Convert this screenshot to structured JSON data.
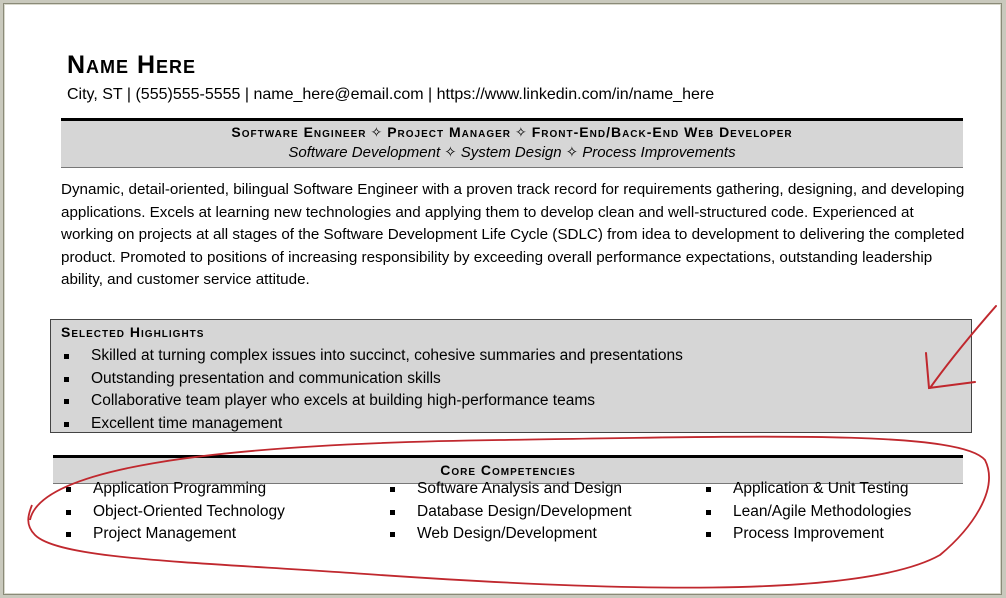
{
  "header": {
    "name": "Name Here",
    "contact": "City, ST | (555)555-5555 | name_here@email.com | https://www.linkedin.com/in/name_here"
  },
  "title_bar": {
    "roles": [
      "Software Engineer",
      "Project Manager",
      "Front-End/Back-End Web Developer"
    ],
    "skills": [
      "Software Development",
      "System Design",
      "Process Improvements"
    ],
    "separator_icon": "four-pointed-star-icon"
  },
  "summary": "Dynamic, detail-oriented, bilingual Software Engineer with a proven track record for requirements gathering, designing, and developing applications. Excels at learning new technologies and applying them to develop clean and well-structured code. Experienced at working on projects at all stages of the Software Development Life Cycle (SDLC) from idea to development to delivering the completed product. Promoted to positions of increasing responsibility by exceeding overall performance expectations, outstanding leadership ability, and customer service attitude.",
  "highlights": {
    "heading": "Selected Highlights",
    "items": [
      "Skilled at turning complex issues into succinct, cohesive summaries and presentations",
      "Outstanding presentation and communication skills",
      "Collaborative team player who excels at building high-performance teams",
      "Excellent time management"
    ]
  },
  "competencies": {
    "heading": "Core Competencies",
    "columns": [
      [
        "Application Programming",
        "Object-Oriented Technology",
        "Project Management"
      ],
      [
        "Software Analysis and Design",
        "Database Design/Development",
        "Web Design/Development"
      ],
      [
        "Application & Unit Testing",
        "Lean/Agile Methodologies",
        "Process Improvement"
      ]
    ]
  },
  "annotations": {
    "color": "#c0282e",
    "items": [
      "arrow pointing at highlights box",
      "ellipse circling core competencies"
    ]
  }
}
